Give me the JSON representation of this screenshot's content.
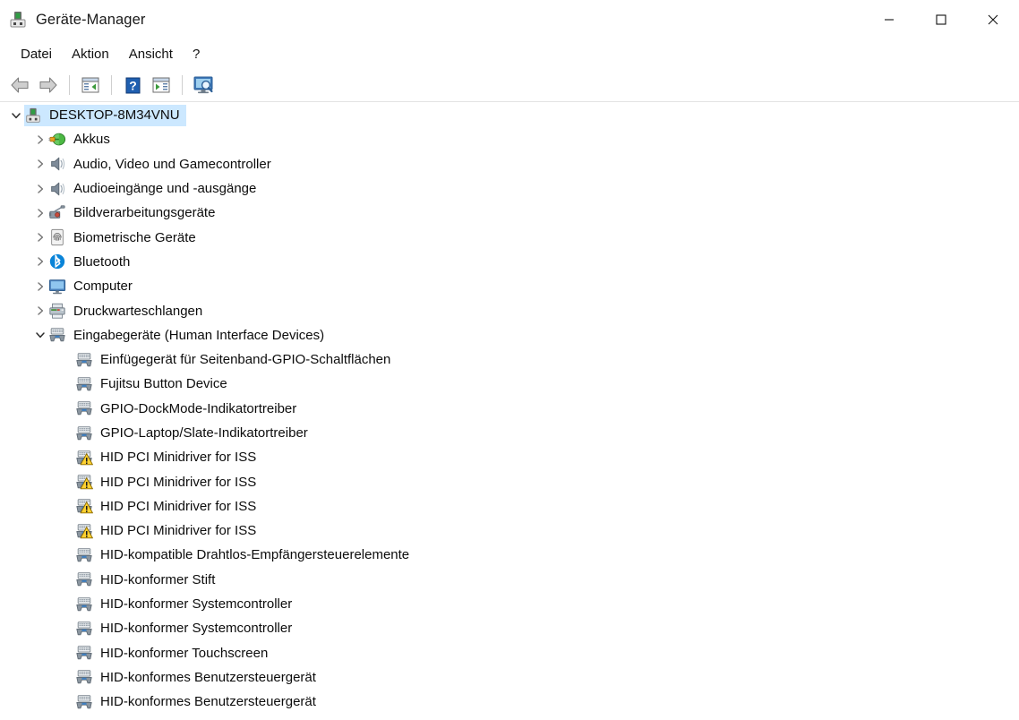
{
  "window": {
    "title": "Geräte-Manager",
    "app_icon": "device-manager-icon",
    "controls": {
      "minimize": "Minimieren",
      "maximize": "Maximieren",
      "close": "Schließen"
    }
  },
  "menubar": {
    "items": [
      {
        "label": "Datei",
        "name": "menu-datei"
      },
      {
        "label": "Aktion",
        "name": "menu-aktion"
      },
      {
        "label": "Ansicht",
        "name": "menu-ansicht"
      },
      {
        "label": "?",
        "name": "menu-hilfe"
      }
    ]
  },
  "toolbar": {
    "buttons": [
      {
        "icon": "back-arrow-icon",
        "title": "Zurück"
      },
      {
        "icon": "forward-arrow-icon",
        "title": "Vorwärts"
      },
      {
        "icon": "properties-icon",
        "title": "Eigenschaften"
      },
      {
        "icon": "help-icon",
        "title": "Hilfe"
      },
      {
        "icon": "update-driver-icon",
        "title": "Treiber aktualisieren"
      },
      {
        "icon": "scan-hardware-icon",
        "title": "Nach geänderter Hardware suchen"
      }
    ]
  },
  "tree": {
    "root": {
      "label": "DESKTOP-8M34VNU",
      "icon": "computer-node-icon",
      "expanded": true,
      "selected": true
    },
    "categories": [
      {
        "label": "Akkus",
        "icon": "battery-icon",
        "expanded": false
      },
      {
        "label": "Audio, Video und Gamecontroller",
        "icon": "speaker-icon",
        "expanded": false
      },
      {
        "label": "Audioeingänge und -ausgänge",
        "icon": "speaker-icon",
        "expanded": false
      },
      {
        "label": "Bildverarbeitungsgeräte",
        "icon": "camera-icon",
        "expanded": false
      },
      {
        "label": "Biometrische Geräte",
        "icon": "fingerprint-icon",
        "expanded": false
      },
      {
        "label": "Bluetooth",
        "icon": "bluetooth-icon",
        "expanded": false
      },
      {
        "label": "Computer",
        "icon": "monitor-icon",
        "expanded": false
      },
      {
        "label": "Druckwarteschlangen",
        "icon": "printer-icon",
        "expanded": false
      },
      {
        "label": "Eingabegeräte (Human Interface Devices)",
        "icon": "hid-icon",
        "expanded": true
      }
    ],
    "hid_children": [
      {
        "label": "Einfügegerät für Seitenband-GPIO-Schaltflächen",
        "icon": "hid-icon",
        "warning": false
      },
      {
        "label": "Fujitsu Button Device",
        "icon": "hid-icon",
        "warning": false
      },
      {
        "label": "GPIO-DockMode-Indikatortreiber",
        "icon": "hid-icon",
        "warning": false
      },
      {
        "label": "GPIO-Laptop/Slate-Indikatortreiber",
        "icon": "hid-icon",
        "warning": false
      },
      {
        "label": "HID PCI Minidriver for ISS",
        "icon": "hid-icon",
        "warning": true
      },
      {
        "label": "HID PCI Minidriver for ISS",
        "icon": "hid-icon",
        "warning": true
      },
      {
        "label": "HID PCI Minidriver for ISS",
        "icon": "hid-icon",
        "warning": true
      },
      {
        "label": "HID PCI Minidriver for ISS",
        "icon": "hid-icon",
        "warning": true
      },
      {
        "label": "HID-kompatible Drahtlos-Empfängersteuerelemente",
        "icon": "hid-icon",
        "warning": false
      },
      {
        "label": "HID-konformer Stift",
        "icon": "hid-icon",
        "warning": false
      },
      {
        "label": "HID-konformer Systemcontroller",
        "icon": "hid-icon",
        "warning": false
      },
      {
        "label": "HID-konformer Systemcontroller",
        "icon": "hid-icon",
        "warning": false
      },
      {
        "label": "HID-konformer Touchscreen",
        "icon": "hid-icon",
        "warning": false
      },
      {
        "label": "HID-konformes Benutzersteuergerät",
        "icon": "hid-icon",
        "warning": false
      },
      {
        "label": "HID-konformes Benutzersteuergerät",
        "icon": "hid-icon",
        "warning": false
      }
    ]
  },
  "colors": {
    "selection": "#cce8ff",
    "warning_yellow": "#ffd230",
    "bluetooth_blue": "#0a84d8",
    "accent": "#0078d7"
  }
}
